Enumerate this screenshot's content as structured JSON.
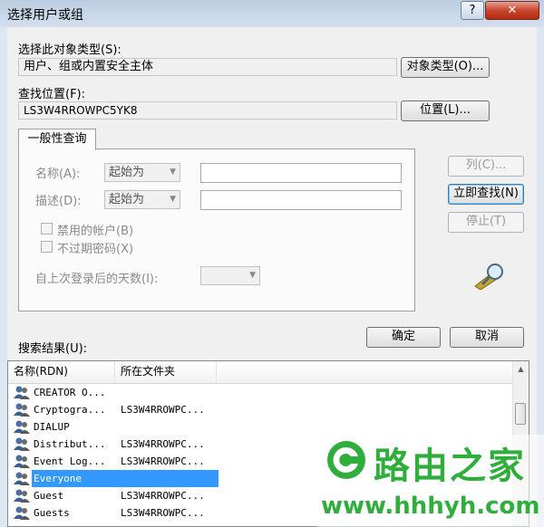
{
  "window": {
    "title": "选择用户或组",
    "help_label": "?",
    "close_label": "✕"
  },
  "object_type": {
    "label": "选择此对象类型(S):",
    "value": "用户、组或内置安全主体",
    "button": "对象类型(O)..."
  },
  "location": {
    "label": "查找位置(F):",
    "value": "LS3W4RROWPC5YK8",
    "button": "位置(L)..."
  },
  "query": {
    "tab_label": "一般性查询",
    "name_label": "名称(A):",
    "name_mode": "起始为",
    "desc_label": "描述(D):",
    "desc_mode": "起始为",
    "disabled_accounts": "禁用的帐户(B)",
    "non_expiring_pw": "不过期密码(X)",
    "days_since_logon": "自上次登录后的天数(I):"
  },
  "side_buttons": {
    "columns": "列(C)...",
    "find_now": "立即查找(N)",
    "stop": "停止(T)"
  },
  "actions": {
    "ok": "确定",
    "cancel": "取消"
  },
  "results": {
    "label": "搜索结果(U):",
    "columns": [
      "名称(RDN)",
      "所在文件夹"
    ],
    "rows": [
      {
        "name": "CREATOR O...",
        "folder": ""
      },
      {
        "name": "Cryptogra...",
        "folder": "LS3W4RROWPC..."
      },
      {
        "name": "DIALUP",
        "folder": ""
      },
      {
        "name": "Distribut...",
        "folder": "LS3W4RROWPC..."
      },
      {
        "name": "Event Log...",
        "folder": "LS3W4RROWPC..."
      },
      {
        "name": "Everyone",
        "folder": ""
      },
      {
        "name": "Guest",
        "folder": "LS3W4RROWPC..."
      },
      {
        "name": "Guests",
        "folder": "LS3W4RROWPC..."
      }
    ],
    "selected_index": 5
  },
  "watermark": {
    "text": "路由之家",
    "url": "www.hhhyh.com"
  }
}
